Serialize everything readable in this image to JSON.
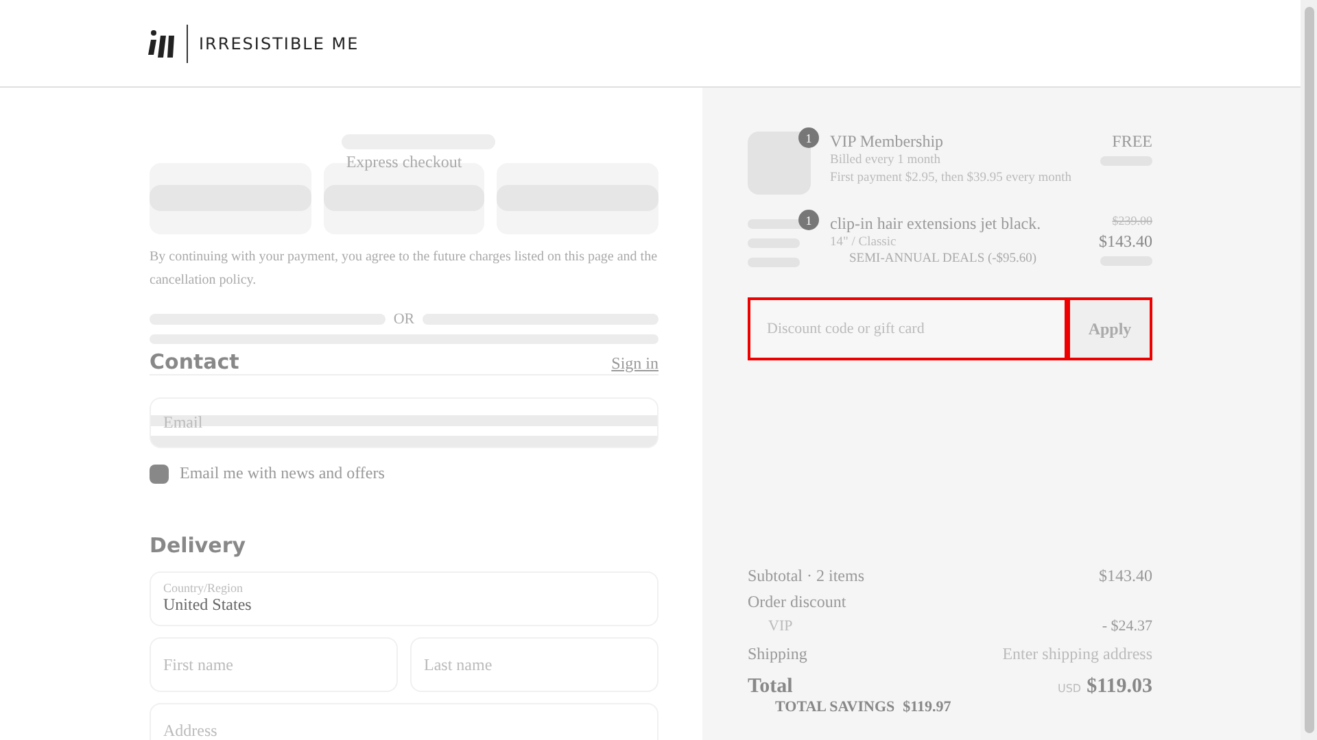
{
  "header": {
    "brand": "IRRESISTIBLE ME"
  },
  "express": {
    "title": "Express checkout",
    "notice": "By continuing with your payment, you agree to the future charges listed on this page and the cancellation policy.",
    "divider": "OR"
  },
  "contact": {
    "title": "Contact",
    "sign_in": "Sign in",
    "email": {
      "placeholder": "Email"
    },
    "newsletter": {
      "label": "Email me with news and offers",
      "checked": false
    }
  },
  "delivery": {
    "title": "Delivery",
    "country": {
      "label": "Country/Region",
      "value": "United States"
    },
    "first_name": {
      "placeholder": "First name"
    },
    "last_name": {
      "placeholder": "Last name"
    },
    "address": {
      "placeholder": "Address"
    }
  },
  "order": {
    "items": [
      {
        "kind": "membership",
        "quantity": "1",
        "name": "VIP Membership",
        "details": [
          "Billed every 1 month",
          "First payment $2.95, then $39.95 every month"
        ],
        "price": "FREE"
      },
      {
        "kind": "product",
        "quantity": "1",
        "name": "clip-in hair extensions jet black.",
        "details": [
          "14\" / Classic"
        ],
        "discount": "SEMI-ANNUAL DEALS (-$95.60)",
        "old_price": "$239.00",
        "price": "$143.40"
      }
    ],
    "discount": {
      "placeholder": "Discount code or gift card",
      "button": "Apply"
    },
    "summary": [
      {
        "kind": "line",
        "label": "Subtotal · 2 items",
        "value": "$143.40"
      },
      {
        "kind": "heading",
        "label": "Order discount"
      },
      {
        "kind": "sub",
        "label": "VIP",
        "value": "- $24.37"
      },
      {
        "kind": "hint",
        "label": "Shipping",
        "value": "Enter shipping address"
      }
    ],
    "total": {
      "label": "Total",
      "currency": "USD",
      "value": "$119.03"
    },
    "savings": {
      "label": "TOTAL SAVINGS",
      "value": "$119.97"
    }
  }
}
